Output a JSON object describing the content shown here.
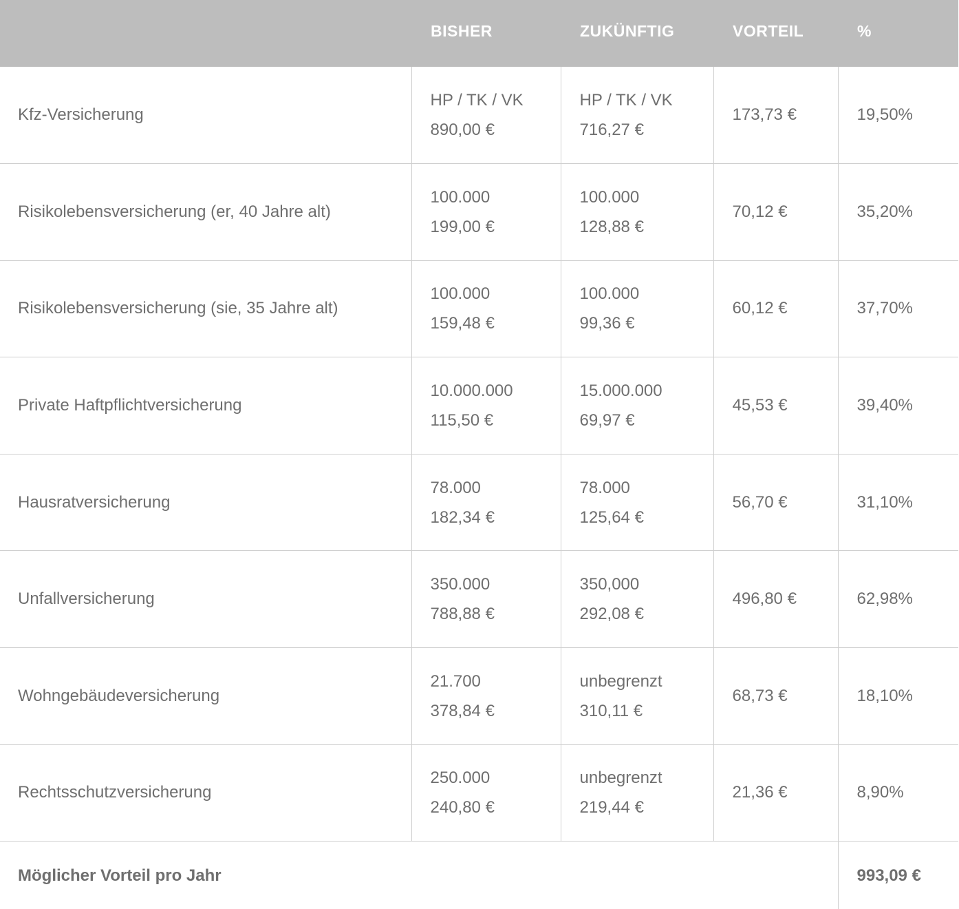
{
  "header": {
    "col_bisher": "BISHER",
    "col_zukuenftig": "ZUKÜNFTIG",
    "col_vorteil": "VORTEIL",
    "col_percent": "%"
  },
  "rows": [
    {
      "label": "Kfz-Versicherung",
      "bisher_top": "HP / TK / VK",
      "bisher_bottom": "890,00 €",
      "zukuenftig_top": "HP / TK / VK",
      "zukuenftig_bottom": "716,27 €",
      "vorteil": "173,73 €",
      "percent": "19,50%"
    },
    {
      "label": "Risikolebensversicherung (er, 40 Jahre alt)",
      "bisher_top": "100.000",
      "bisher_bottom": "199,00 €",
      "zukuenftig_top": "100.000",
      "zukuenftig_bottom": "128,88 €",
      "vorteil": "70,12 €",
      "percent": "35,20%"
    },
    {
      "label": "Risikolebensversicherung (sie, 35 Jahre alt)",
      "bisher_top": "100.000",
      "bisher_bottom": "159,48 €",
      "zukuenftig_top": "100.000",
      "zukuenftig_bottom": "99,36 €",
      "vorteil": "60,12 €",
      "percent": "37,70%"
    },
    {
      "label": "Private Haftpflichtversicherung",
      "bisher_top": "10.000.000",
      "bisher_bottom": "115,50 €",
      "zukuenftig_top": "15.000.000",
      "zukuenftig_bottom": "69,97 €",
      "vorteil": "45,53 €",
      "percent": "39,40%"
    },
    {
      "label": "Hausratversicherung",
      "bisher_top": "78.000",
      "bisher_bottom": "182,34 €",
      "zukuenftig_top": "78.000",
      "zukuenftig_bottom": "125,64 €",
      "vorteil": "56,70 €",
      "percent": "31,10%"
    },
    {
      "label": "Unfallversicherung",
      "bisher_top": "350.000",
      "bisher_bottom": "788,88 €",
      "zukuenftig_top": "350,000",
      "zukuenftig_bottom": "292,08 €",
      "vorteil": "496,80 €",
      "percent": "62,98%"
    },
    {
      "label": "Wohngebäudeversicherung",
      "bisher_top": "21.700",
      "bisher_bottom": "378,84 €",
      "zukuenftig_top": "unbegrenzt",
      "zukuenftig_bottom": "310,11 €",
      "vorteil": "68,73 €",
      "percent": "18,10%"
    },
    {
      "label": "Rechtsschutzversicherung",
      "bisher_top": "250.000",
      "bisher_bottom": "240,80 €",
      "zukuenftig_top": "unbegrenzt",
      "zukuenftig_bottom": "219,44 €",
      "vorteil": "21,36 €",
      "percent": "8,90%"
    }
  ],
  "total": {
    "label": "Möglicher Vorteil pro Jahr",
    "value": "993,09 €"
  }
}
